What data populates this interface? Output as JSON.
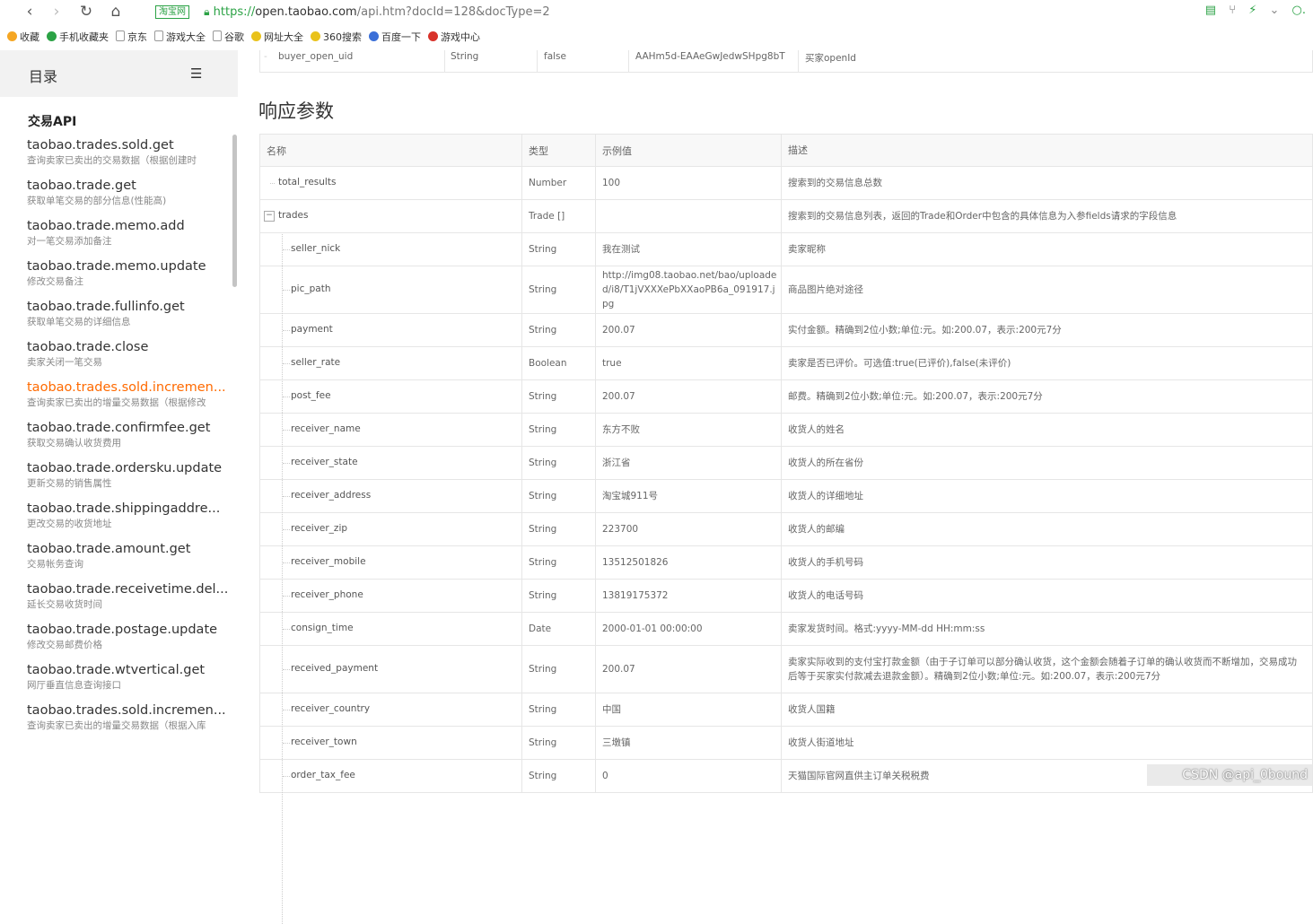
{
  "browser": {
    "url_badge": "淘宝网",
    "url_scheme": "https://",
    "url_host": "open.taobao.com",
    "url_rest": "/api.htm?docId=128&docType=2",
    "bookmarks": [
      "收藏",
      "手机收藏夹",
      "京东",
      "游戏大全",
      "谷歌",
      "网址大全",
      "360搜索",
      "百度一下",
      "游戏中心"
    ]
  },
  "sidebar": {
    "title": "目录",
    "section": "交易API",
    "items": [
      {
        "title": "taobao.trades.sold.get",
        "desc": "查询卖家已卖出的交易数据（根据创建时",
        "active": false
      },
      {
        "title": "taobao.trade.get",
        "desc": "获取单笔交易的部分信息(性能高)",
        "active": false
      },
      {
        "title": "taobao.trade.memo.add",
        "desc": "对一笔交易添加备注",
        "active": false
      },
      {
        "title": "taobao.trade.memo.update",
        "desc": "修改交易备注",
        "active": false
      },
      {
        "title": "taobao.trade.fullinfo.get",
        "desc": "获取单笔交易的详细信息",
        "active": false
      },
      {
        "title": "taobao.trade.close",
        "desc": "卖家关闭一笔交易",
        "active": false
      },
      {
        "title": "taobao.trades.sold.incremen...",
        "desc": "查询卖家已卖出的增量交易数据（根据修改",
        "active": true
      },
      {
        "title": "taobao.trade.confirmfee.get",
        "desc": "获取交易确认收货费用",
        "active": false
      },
      {
        "title": "taobao.trade.ordersku.update",
        "desc": "更新交易的销售属性",
        "active": false
      },
      {
        "title": "taobao.trade.shippingaddre...",
        "desc": "更改交易的收货地址",
        "active": false
      },
      {
        "title": "taobao.trade.amount.get",
        "desc": "交易帐务查询",
        "active": false
      },
      {
        "title": "taobao.trade.receivetime.del...",
        "desc": "延长交易收货时间",
        "active": false
      },
      {
        "title": "taobao.trade.postage.update",
        "desc": "修改交易邮费价格",
        "active": false
      },
      {
        "title": "taobao.trade.wtvertical.get",
        "desc": "网厅垂直信息查询接口",
        "active": false
      },
      {
        "title": "taobao.trades.sold.incremen...",
        "desc": "查询卖家已卖出的增量交易数据（根据入库",
        "active": false
      }
    ]
  },
  "prev_row": {
    "name": "buyer_open_uid",
    "type": "String",
    "required": "false",
    "example": "AAHm5d-EAAeGwJedwSHpg8bT",
    "desc": "买家openId"
  },
  "section_title": "响应参数",
  "table": {
    "headers": [
      "名称",
      "类型",
      "示例值",
      "描述"
    ],
    "rows": [
      {
        "name": "total_results",
        "type": "Number",
        "example": "100",
        "desc": "搜索到的交易信息总数",
        "level": 0,
        "h": 36
      },
      {
        "name": "trades",
        "type": "Trade []",
        "example": "",
        "desc": "搜索到的交易信息列表，返回的Trade和Order中包含的具体信息为入参fields请求的字段信息",
        "level": 0,
        "h": 36,
        "parent": true
      },
      {
        "name": "seller_nick",
        "type": "String",
        "example": "我在测试",
        "desc": "卖家昵称",
        "level": 1,
        "h": 36
      },
      {
        "name": "pic_path",
        "type": "String",
        "example": "http://img08.taobao.net/bao/uploaded/i8/T1jVXXXePbXXaoPB6a_091917.jpg",
        "desc": "商品图片绝对途径",
        "level": 1,
        "h": 52
      },
      {
        "name": "payment",
        "type": "String",
        "example": "200.07",
        "desc": "实付金额。精确到2位小数;单位:元。如:200.07，表示:200元7分",
        "level": 1,
        "h": 36
      },
      {
        "name": "seller_rate",
        "type": "Boolean",
        "example": "true",
        "desc": "卖家是否已评价。可选值:true(已评价),false(未评价)",
        "level": 1,
        "h": 36
      },
      {
        "name": "post_fee",
        "type": "String",
        "example": "200.07",
        "desc": "邮费。精确到2位小数;单位:元。如:200.07，表示:200元7分",
        "level": 1,
        "h": 36
      },
      {
        "name": "receiver_name",
        "type": "String",
        "example": "东方不败",
        "desc": "收货人的姓名",
        "level": 1,
        "h": 36
      },
      {
        "name": "receiver_state",
        "type": "String",
        "example": "浙江省",
        "desc": "收货人的所在省份",
        "level": 1,
        "h": 36
      },
      {
        "name": "receiver_address",
        "type": "String",
        "example": "淘宝城911号",
        "desc": "收货人的详细地址",
        "level": 1,
        "h": 36
      },
      {
        "name": "receiver_zip",
        "type": "String",
        "example": "223700",
        "desc": "收货人的邮编",
        "level": 1,
        "h": 36
      },
      {
        "name": "receiver_mobile",
        "type": "String",
        "example": "13512501826",
        "desc": "收货人的手机号码",
        "level": 1,
        "h": 36
      },
      {
        "name": "receiver_phone",
        "type": "String",
        "example": "13819175372",
        "desc": "收货人的电话号码",
        "level": 1,
        "h": 36
      },
      {
        "name": "consign_time",
        "type": "Date",
        "example": "2000-01-01 00:00:00",
        "desc": "卖家发货时间。格式:yyyy-MM-dd HH:mm:ss",
        "level": 1,
        "h": 36
      },
      {
        "name": "received_payment",
        "type": "String",
        "example": "200.07",
        "desc": "卖家实际收到的支付宝打款金额（由于子订单可以部分确认收货，这个金额会随着子订单的确认收货而不断增加，交易成功后等于买家实付款减去退款金额）。精确到2位小数;单位:元。如:200.07，表示:200元7分",
        "level": 1,
        "h": 52
      },
      {
        "name": "receiver_country",
        "type": "String",
        "example": "中国",
        "desc": "收货人国籍",
        "level": 1,
        "h": 36
      },
      {
        "name": "receiver_town",
        "type": "String",
        "example": "三墩镇",
        "desc": "收货人街道地址",
        "level": 1,
        "h": 36
      },
      {
        "name": "order_tax_fee",
        "type": "String",
        "example": "0",
        "desc": "天猫国际官网直供主订单关税税费",
        "level": 1,
        "h": 36
      }
    ]
  },
  "watermark": "CSDN @api_0bound"
}
